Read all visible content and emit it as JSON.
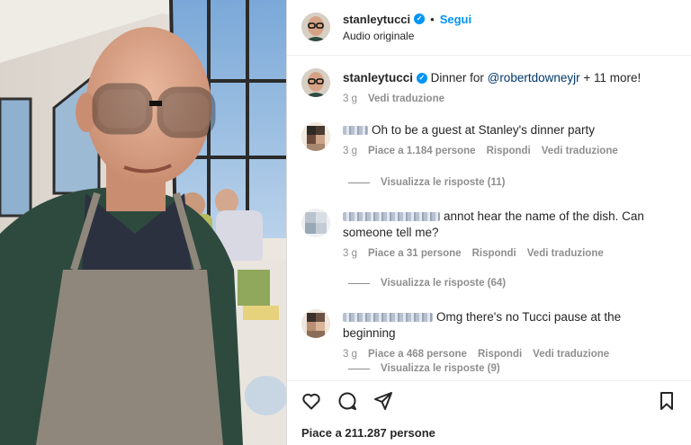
{
  "post": {
    "username": "stanleytucci",
    "follow_label": "Segui",
    "audio_label": "Audio originale",
    "separator": "•"
  },
  "caption": {
    "username": "stanleytucci",
    "text_before": "Dinner for ",
    "mention": "@robertdowneyjr",
    "text_after": " + 11 more!",
    "time": "3 g",
    "translate_label": "Vedi traduzione"
  },
  "comments": [
    {
      "text": "Oh to be a guest at Stanley's dinner party",
      "time": "3 g",
      "likes": "Piace a 1.184 persone",
      "reply_label": "Rispondi",
      "translate_label": "Vedi traduzione",
      "view_replies": "Visualizza le risposte (11)"
    },
    {
      "text": "annot hear the name of the dish. Can someone tell me?",
      "time": "3 g",
      "likes": "Piace a 31 persone",
      "reply_label": "Rispondi",
      "translate_label": "Vedi traduzione",
      "view_replies": "Visualizza le risposte (64)"
    },
    {
      "text": "Omg there's no Tucci pause at the beginning",
      "time": "3 g",
      "likes": "Piace a 468 persone",
      "reply_label": "Rispondi",
      "translate_label": "Vedi traduzione",
      "view_replies": "Visualizza le risposte (9)"
    }
  ],
  "footer": {
    "likes_total": "Piace a 211.287 persone"
  },
  "icons": {
    "like": "heart-icon",
    "comment": "comment-icon",
    "share": "paper-plane-icon",
    "save": "bookmark-icon",
    "verified": "verified-badge-icon"
  },
  "colors": {
    "accent": "#0095f6",
    "muted": "#8e8e8e",
    "text": "#262626",
    "mention": "#00376b"
  }
}
